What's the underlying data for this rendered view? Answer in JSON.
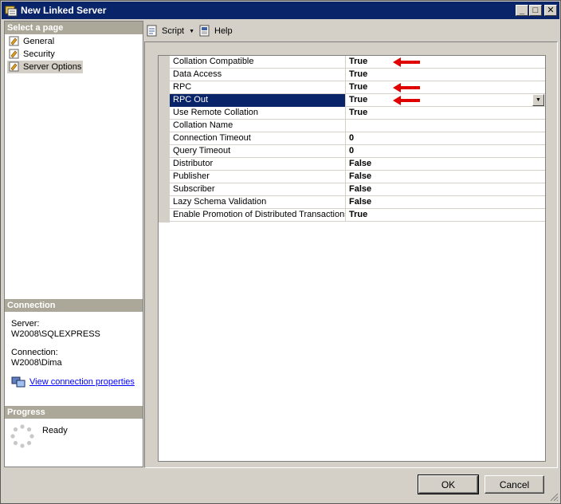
{
  "window": {
    "title": "New Linked Server",
    "min_glyph": "_",
    "max_glyph": "□",
    "close_glyph": "✕"
  },
  "left": {
    "select_header": "Select a page",
    "pages": [
      {
        "label": "General"
      },
      {
        "label": "Security"
      },
      {
        "label": "Server Options"
      }
    ],
    "connection_header": "Connection",
    "server_label": "Server:",
    "server_value": "W2008\\SQLEXPRESS",
    "connection_label": "Connection:",
    "connection_value": "W2008\\Dima",
    "view_props_link": "View connection properties",
    "progress_header": "Progress",
    "progress_status": "Ready"
  },
  "toolbar": {
    "script_label": "Script",
    "help_label": "Help"
  },
  "properties": [
    {
      "name": "Collation Compatible",
      "value": "True",
      "arrow": true
    },
    {
      "name": "Data Access",
      "value": "True"
    },
    {
      "name": "RPC",
      "value": "True",
      "arrow": true
    },
    {
      "name": "RPC Out",
      "value": "True",
      "arrow": true,
      "selected": true
    },
    {
      "name": "Use Remote Collation",
      "value": "True"
    },
    {
      "name": "Collation Name",
      "value": ""
    },
    {
      "name": "Connection Timeout",
      "value": "0"
    },
    {
      "name": "Query Timeout",
      "value": "0"
    },
    {
      "name": "Distributor",
      "value": "False"
    },
    {
      "name": "Publisher",
      "value": "False"
    },
    {
      "name": "Subscriber",
      "value": "False"
    },
    {
      "name": "Lazy Schema Validation",
      "value": "False"
    },
    {
      "name": "Enable Promotion of Distributed Transactions f",
      "value": "True"
    }
  ],
  "footer": {
    "ok_label": "OK",
    "cancel_label": "Cancel"
  },
  "colors": {
    "arrow": "#e00000",
    "title_bar": "#0a246a",
    "selected_row": "#0a246a"
  }
}
